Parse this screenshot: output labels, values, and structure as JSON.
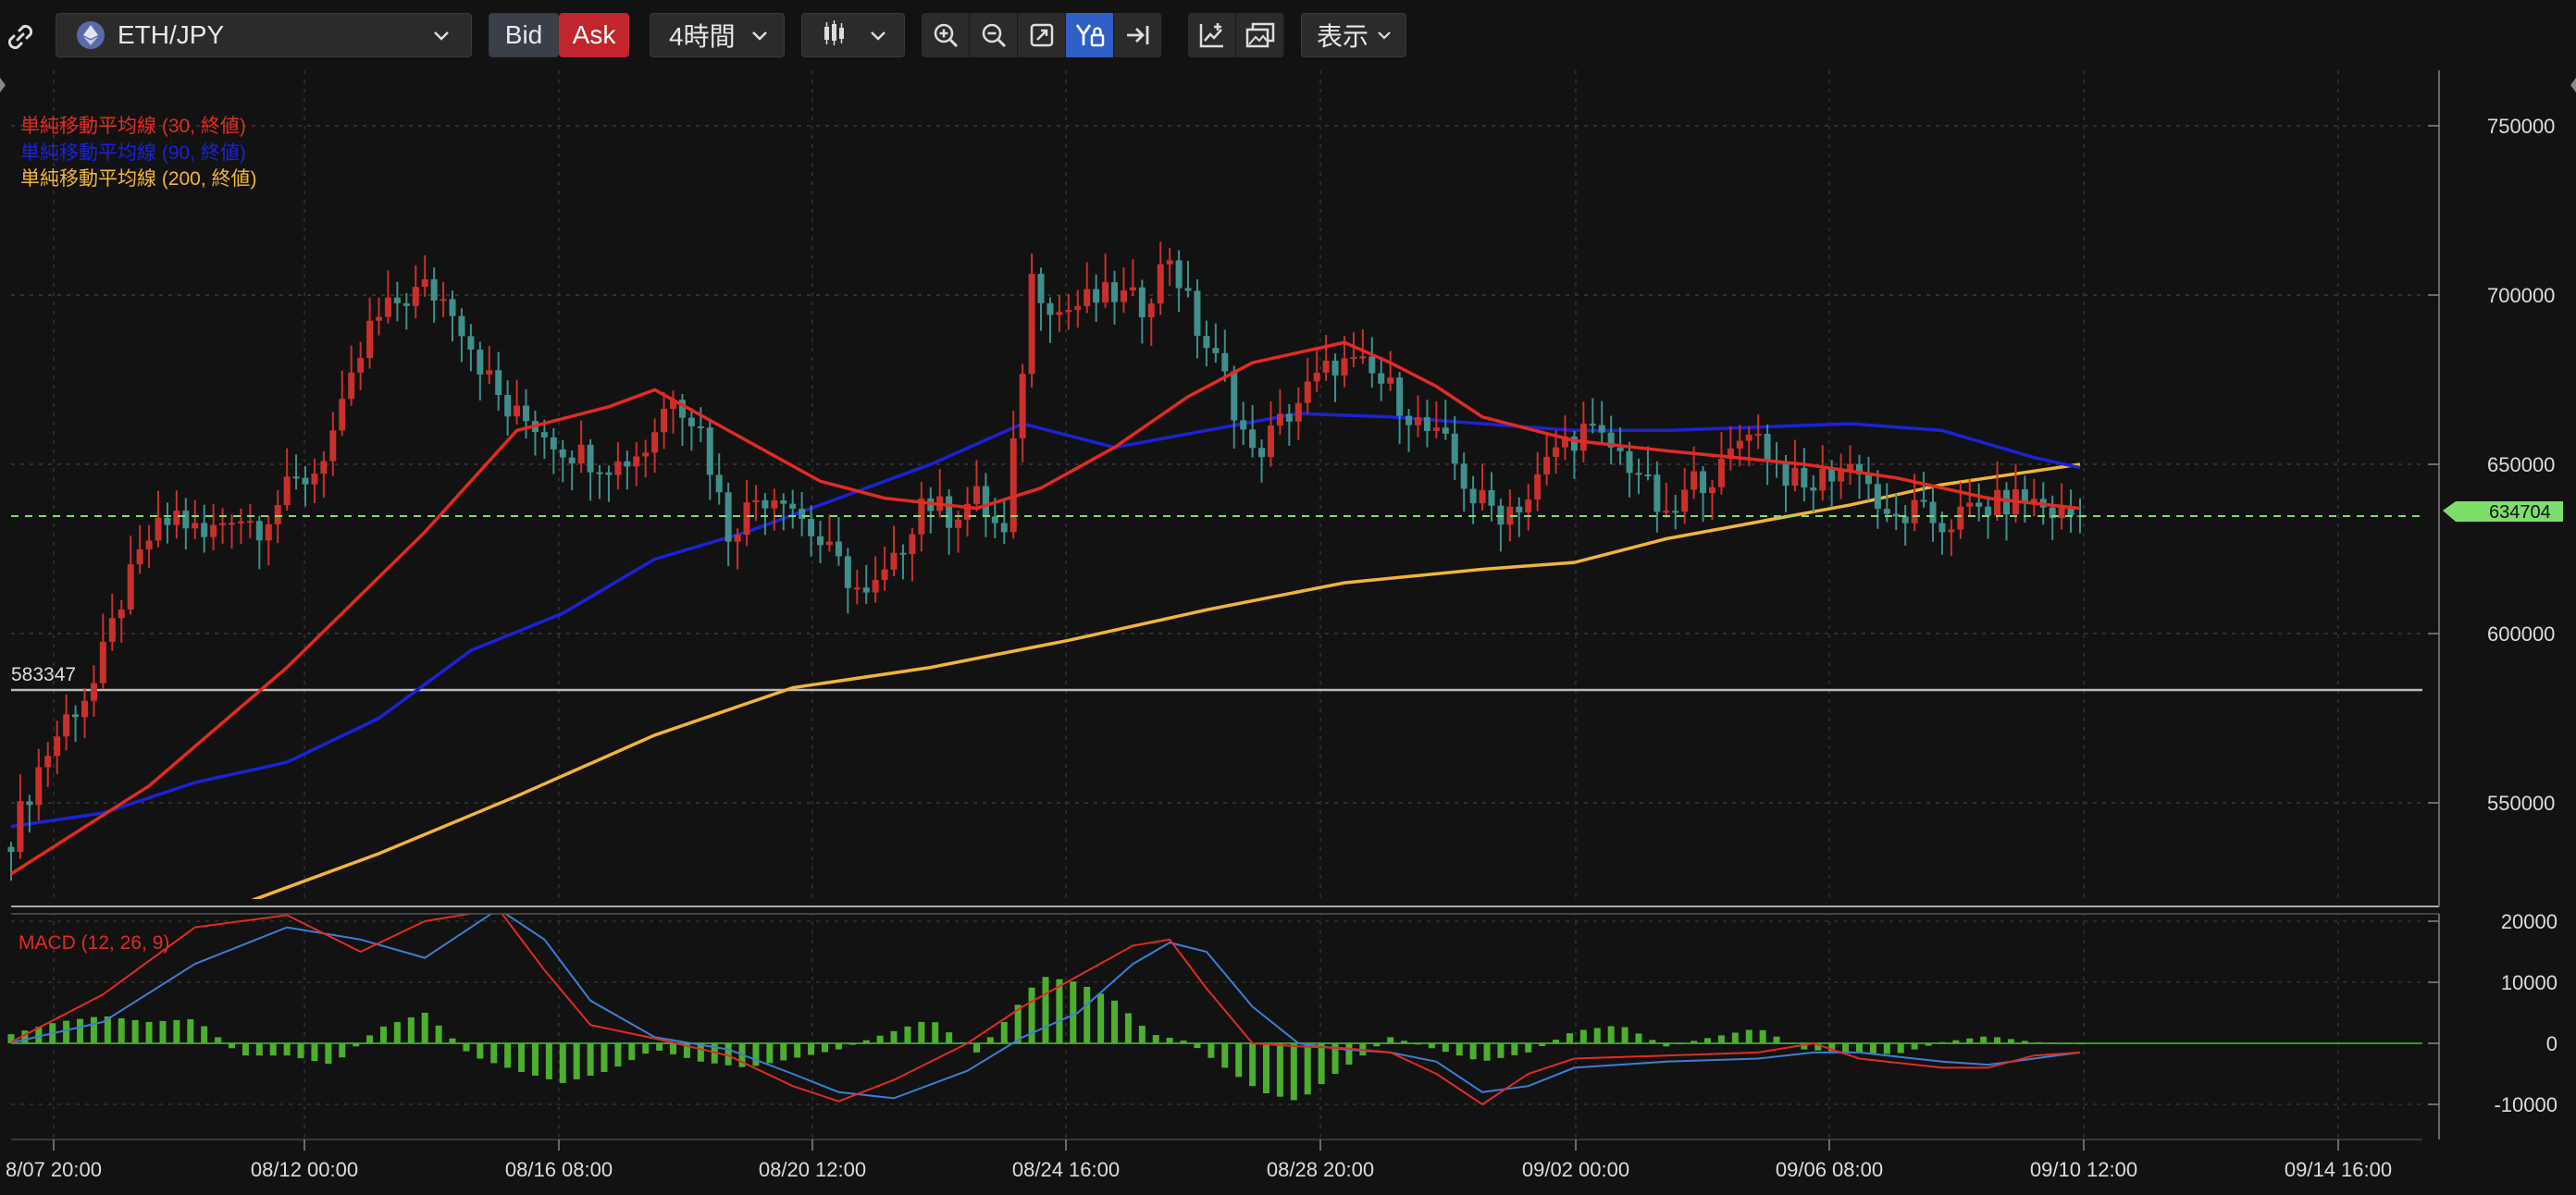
{
  "toolbar": {
    "symbol": "ETH/JPY",
    "bid_label": "Bid",
    "ask_label": "Ask",
    "timeframe": "4時間",
    "display_label": "表示",
    "colors": {
      "ask_bg": "#c0262c",
      "active_tool_bg": "#2f5fc4"
    }
  },
  "indicators": {
    "sma30": {
      "label": "単純移動平均線 (30, 終値)",
      "color": "#e32b22"
    },
    "sma90": {
      "label": "単純移動平均線 (90, 終値)",
      "color": "#1c22d6"
    },
    "sma200": {
      "label": "単純移動平均線 (200, 終値)",
      "color": "#f2b43a"
    }
  },
  "horizontal_line": {
    "label": "583347",
    "value": 583347
  },
  "current_price": {
    "label": "634704",
    "value": 634704,
    "color": "#7dde6a"
  },
  "macd": {
    "label": "MACD (12, 26, 9)"
  },
  "chart_data": {
    "type": "candlestick",
    "price_axis": {
      "ticks": [
        550000,
        600000,
        650000,
        700000,
        750000
      ],
      "labels": [
        "550000",
        "600000",
        "650000",
        "700000",
        "750000"
      ]
    },
    "macd_axis": {
      "ticks": [
        -10000,
        0,
        10000,
        20000
      ],
      "labels": [
        "-10000",
        "0",
        "10000",
        "20000"
      ]
    },
    "time_labels": [
      "8/07 20:00",
      "08/12 00:00",
      "08/16 08:00",
      "08/20 12:00",
      "08/24 16:00",
      "08/28 20:00",
      "09/02 00:00",
      "09/06 08:00",
      "09/10 12:00",
      "09/14 16:00"
    ],
    "close_series": [
      [
        0,
        540000
      ],
      [
        3,
        560000
      ],
      [
        6,
        575000
      ],
      [
        9,
        585000
      ],
      [
        12,
        610000
      ],
      [
        15,
        628000
      ],
      [
        18,
        635000
      ],
      [
        21,
        628000
      ],
      [
        24,
        636000
      ],
      [
        27,
        632000
      ],
      [
        30,
        642000
      ],
      [
        33,
        648000
      ],
      [
        36,
        665000
      ],
      [
        39,
        690000
      ],
      [
        42,
        698000
      ],
      [
        45,
        702000
      ],
      [
        48,
        697000
      ],
      [
        51,
        680000
      ],
      [
        54,
        665000
      ],
      [
        57,
        662000
      ],
      [
        60,
        655000
      ],
      [
        63,
        652000
      ],
      [
        66,
        650000
      ],
      [
        69,
        655000
      ],
      [
        72,
        672000
      ],
      [
        75,
        660000
      ],
      [
        78,
        630000
      ],
      [
        81,
        640000
      ],
      [
        84,
        642000
      ],
      [
        87,
        630000
      ],
      [
        90,
        620000
      ],
      [
        93,
        610000
      ],
      [
        96,
        620000
      ],
      [
        99,
        640000
      ],
      [
        102,
        635000
      ],
      [
        105,
        640000
      ],
      [
        108,
        628000
      ],
      [
        111,
        705000
      ],
      [
        114,
        695000
      ],
      [
        117,
        698000
      ],
      [
        120,
        700000
      ],
      [
        123,
        697000
      ],
      [
        126,
        712000
      ],
      [
        129,
        690000
      ],
      [
        132,
        675000
      ],
      [
        135,
        652000
      ],
      [
        138,
        662000
      ],
      [
        141,
        672000
      ],
      [
        144,
        680000
      ],
      [
        147,
        678000
      ],
      [
        150,
        672000
      ],
      [
        153,
        662000
      ],
      [
        156,
        655000
      ],
      [
        159,
        640000
      ],
      [
        162,
        636000
      ],
      [
        165,
        640000
      ],
      [
        168,
        655000
      ],
      [
        171,
        660000
      ],
      [
        174,
        655000
      ],
      [
        177,
        648000
      ],
      [
        180,
        632000
      ],
      [
        183,
        645000
      ],
      [
        186,
        648000
      ],
      [
        189,
        662000
      ],
      [
        192,
        650000
      ],
      [
        195,
        642000
      ],
      [
        198,
        648000
      ],
      [
        201,
        650000
      ],
      [
        204,
        632000
      ],
      [
        207,
        636000
      ],
      [
        210,
        632000
      ],
      [
        213,
        636000
      ],
      [
        216,
        638000
      ],
      [
        219,
        640000
      ],
      [
        222,
        636000
      ],
      [
        225,
        634704
      ]
    ],
    "sma30": [
      [
        0,
        529000
      ],
      [
        15,
        555000
      ],
      [
        30,
        590000
      ],
      [
        45,
        630000
      ],
      [
        55,
        660000
      ],
      [
        65,
        667000
      ],
      [
        70,
        672000
      ],
      [
        78,
        660000
      ],
      [
        88,
        645000
      ],
      [
        95,
        640000
      ],
      [
        105,
        637000
      ],
      [
        112,
        643000
      ],
      [
        120,
        655000
      ],
      [
        128,
        670000
      ],
      [
        135,
        680000
      ],
      [
        140,
        683000
      ],
      [
        145,
        686000
      ],
      [
        150,
        680000
      ],
      [
        155,
        673000
      ],
      [
        160,
        664000
      ],
      [
        170,
        657000
      ],
      [
        180,
        654000
      ],
      [
        195,
        650000
      ],
      [
        205,
        646000
      ],
      [
        215,
        640000
      ],
      [
        225,
        637000
      ]
    ],
    "sma90": [
      [
        0,
        543000
      ],
      [
        10,
        547000
      ],
      [
        20,
        556000
      ],
      [
        30,
        562000
      ],
      [
        40,
        575000
      ],
      [
        50,
        595000
      ],
      [
        60,
        606000
      ],
      [
        70,
        622000
      ],
      [
        80,
        630000
      ],
      [
        90,
        640000
      ],
      [
        100,
        650000
      ],
      [
        110,
        662000
      ],
      [
        120,
        655000
      ],
      [
        130,
        660000
      ],
      [
        140,
        665000
      ],
      [
        150,
        664000
      ],
      [
        160,
        662000
      ],
      [
        170,
        660000
      ],
      [
        180,
        660000
      ],
      [
        190,
        661000
      ],
      [
        200,
        662000
      ],
      [
        210,
        660000
      ],
      [
        220,
        652000
      ],
      [
        225,
        649000
      ]
    ],
    "sma200": [
      [
        25,
        520000
      ],
      [
        40,
        535000
      ],
      [
        55,
        552000
      ],
      [
        70,
        570000
      ],
      [
        85,
        584000
      ],
      [
        100,
        590000
      ],
      [
        115,
        598000
      ],
      [
        130,
        607000
      ],
      [
        145,
        615000
      ],
      [
        160,
        619000
      ],
      [
        170,
        621000
      ],
      [
        180,
        628000
      ],
      [
        190,
        633000
      ],
      [
        200,
        638000
      ],
      [
        210,
        644000
      ],
      [
        225,
        650000
      ]
    ],
    "macd_line": [
      [
        0,
        200
      ],
      [
        10,
        8000
      ],
      [
        20,
        19000
      ],
      [
        30,
        21000
      ],
      [
        38,
        15000
      ],
      [
        45,
        20000
      ],
      [
        53,
        22000
      ],
      [
        58,
        12000
      ],
      [
        63,
        3000
      ],
      [
        70,
        800
      ],
      [
        78,
        -2000
      ],
      [
        85,
        -7000
      ],
      [
        90,
        -9500
      ],
      [
        96,
        -6000
      ],
      [
        104,
        0
      ],
      [
        110,
        6000
      ],
      [
        116,
        11000
      ],
      [
        122,
        16000
      ],
      [
        126,
        17000
      ],
      [
        130,
        9000
      ],
      [
        135,
        0
      ],
      [
        140,
        -500
      ],
      [
        145,
        -800
      ],
      [
        150,
        -1500
      ],
      [
        155,
        -5000
      ],
      [
        160,
        -10000
      ],
      [
        165,
        -5000
      ],
      [
        170,
        -2500
      ],
      [
        180,
        -2000
      ],
      [
        190,
        -1500
      ],
      [
        196,
        0
      ],
      [
        201,
        -2500
      ],
      [
        210,
        -4000
      ],
      [
        215,
        -4000
      ],
      [
        220,
        -2000
      ],
      [
        225,
        -1500
      ]
    ],
    "signal_line": [
      [
        0,
        100
      ],
      [
        10,
        3500
      ],
      [
        20,
        13000
      ],
      [
        30,
        19000
      ],
      [
        38,
        17000
      ],
      [
        45,
        14000
      ],
      [
        53,
        22000
      ],
      [
        58,
        17000
      ],
      [
        63,
        7000
      ],
      [
        70,
        1000
      ],
      [
        78,
        -1000
      ],
      [
        85,
        -5000
      ],
      [
        90,
        -8000
      ],
      [
        96,
        -9000
      ],
      [
        104,
        -4500
      ],
      [
        110,
        1000
      ],
      [
        116,
        5000
      ],
      [
        122,
        13000
      ],
      [
        126,
        16500
      ],
      [
        130,
        15000
      ],
      [
        135,
        6000
      ],
      [
        140,
        0
      ],
      [
        145,
        -1000
      ],
      [
        150,
        -1500
      ],
      [
        155,
        -3000
      ],
      [
        160,
        -8000
      ],
      [
        165,
        -7000
      ],
      [
        170,
        -4000
      ],
      [
        180,
        -3000
      ],
      [
        190,
        -2500
      ],
      [
        196,
        -1500
      ],
      [
        201,
        -1500
      ],
      [
        210,
        -3000
      ],
      [
        215,
        -3500
      ],
      [
        220,
        -2500
      ],
      [
        225,
        -1500
      ]
    ],
    "histogram": [
      [
        0,
        1500
      ],
      [
        5,
        3500
      ],
      [
        10,
        4500
      ],
      [
        15,
        3500
      ],
      [
        20,
        4000
      ],
      [
        25,
        -2000
      ],
      [
        30,
        -2000
      ],
      [
        35,
        -3500
      ],
      [
        40,
        2500
      ],
      [
        45,
        5000
      ],
      [
        50,
        -2000
      ],
      [
        55,
        -4500
      ],
      [
        60,
        -6500
      ],
      [
        65,
        -4500
      ],
      [
        70,
        -1000
      ],
      [
        75,
        -3000
      ],
      [
        80,
        -4000
      ],
      [
        85,
        -2500
      ],
      [
        90,
        -1000
      ],
      [
        95,
        1500
      ],
      [
        100,
        4000
      ],
      [
        105,
        -1500
      ],
      [
        108,
        3500
      ],
      [
        112,
        11000
      ],
      [
        116,
        10000
      ],
      [
        120,
        7000
      ],
      [
        124,
        1500
      ],
      [
        128,
        300
      ],
      [
        132,
        -4000
      ],
      [
        136,
        -8000
      ],
      [
        140,
        -9500
      ],
      [
        144,
        -5000
      ],
      [
        150,
        1000
      ],
      [
        155,
        -1000
      ],
      [
        160,
        -3000
      ],
      [
        165,
        -1500
      ],
      [
        170,
        2000
      ],
      [
        175,
        3000
      ],
      [
        180,
        -500
      ],
      [
        185,
        1000
      ],
      [
        190,
        2500
      ],
      [
        195,
        -1000
      ],
      [
        200,
        -1500
      ],
      [
        205,
        -1800
      ],
      [
        210,
        200
      ],
      [
        215,
        1200
      ],
      [
        220,
        200
      ],
      [
        225,
        0
      ]
    ]
  }
}
